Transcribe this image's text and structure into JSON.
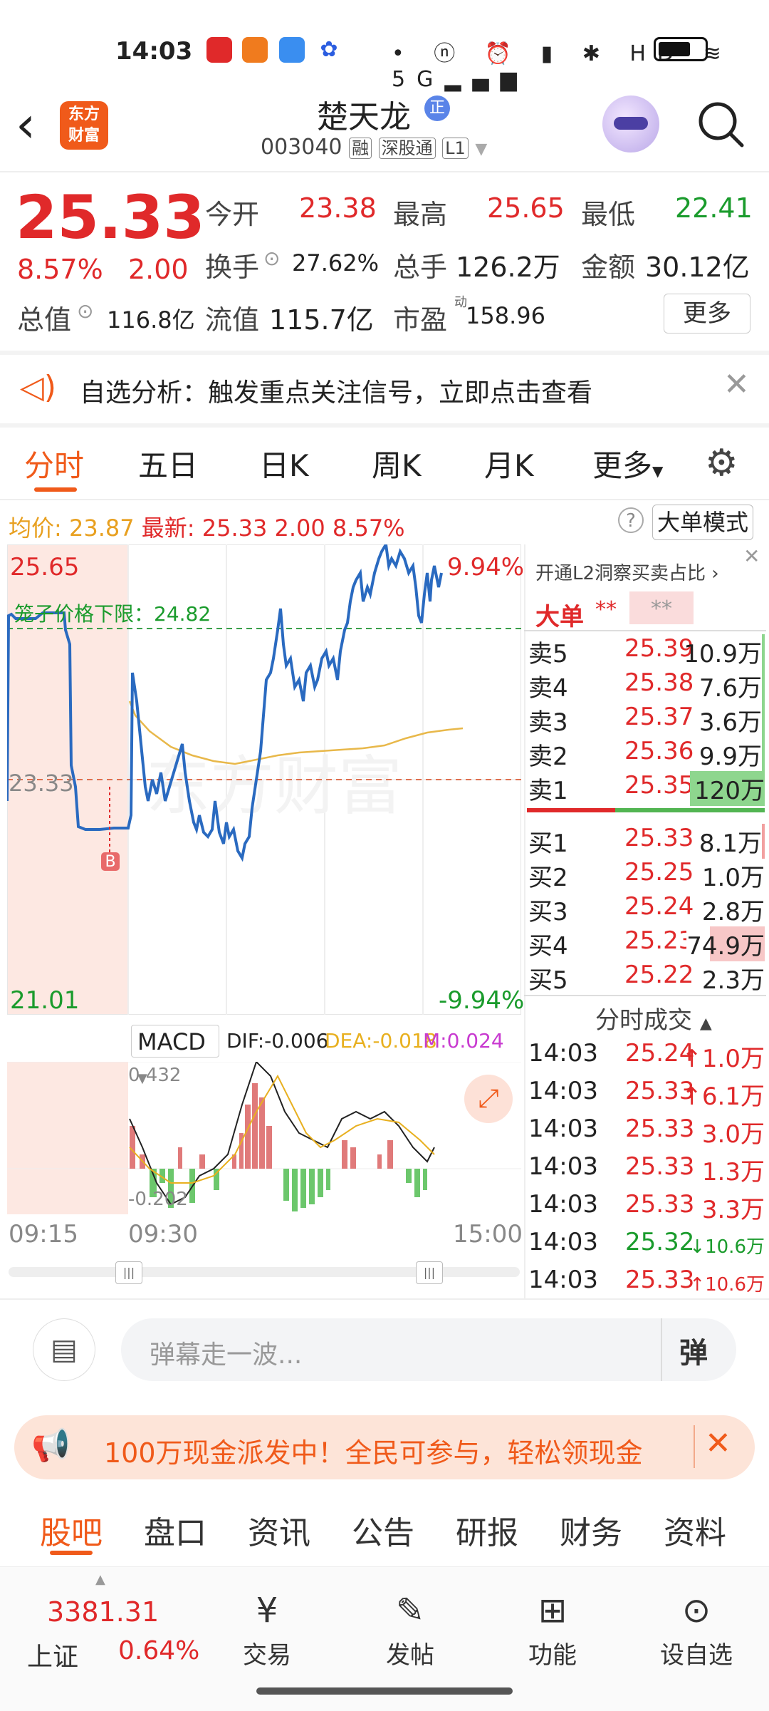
{
  "status": {
    "time": "14:03",
    "icons": "• ⓝ ⏰ ▮ ✱ HD ≋ 5G▂▄▆"
  },
  "header": {
    "logo_top": "东方",
    "logo_bottom": "财富",
    "stock_name": "楚天龙",
    "badge": "正",
    "code": "003040",
    "tag1": "融",
    "tag2": "深股通",
    "tag3": "L1"
  },
  "quote": {
    "price": "25.33",
    "change_pct": "8.57%",
    "change": "2.00",
    "open_label": "今开",
    "open": "23.38",
    "high_label": "最高",
    "high": "25.65",
    "low_label": "最低",
    "low": "22.41",
    "turnover_label": "换手",
    "turnover": "27.62%",
    "volume_label": "总手",
    "volume": "126.2万",
    "amount_label": "金额",
    "amount": "30.12亿",
    "mktcap_label": "总值",
    "mktcap": "116.8亿",
    "float_label": "流值",
    "float": "115.7亿",
    "pe_label": "市盈",
    "pe_sup": "动",
    "pe": "158.96",
    "more": "更多"
  },
  "notice": {
    "text": "自选分析：触发重点关注信号，立即点击查看"
  },
  "tabs": [
    "分时",
    "五日",
    "日K",
    "周K",
    "月K",
    "更多"
  ],
  "chart_info": {
    "avg_label": "均价:",
    "avg": "23.87",
    "last_label": "最新:",
    "last": "25.33",
    "chg": "2.00",
    "pct": "8.57%",
    "mode_button": "大单模式"
  },
  "chart": {
    "top_price": "25.65",
    "top_pct": "9.94%",
    "mid_price": "23.33",
    "bottom_price": "21.01",
    "bottom_pct": "-9.94%",
    "limit_label": "笼子价格下限：24.82",
    "marker": "B",
    "watermark": "东方财富"
  },
  "macd": {
    "selector": "MACD",
    "dif": "DIF:-0.006",
    "dea": "DEA:-0.018",
    "m": "M:0.024",
    "top": "0.432",
    "bottom": "-0.202",
    "t_start": "09:15",
    "t_open": "09:30",
    "t_end": "15:00"
  },
  "orderbook": {
    "promo": "开通L2洞察买卖占比",
    "bigorder_label": "大单",
    "bigorder_val1": "**",
    "bigorder_val2": "**",
    "asks": [
      {
        "label": "卖5",
        "price": "25.39",
        "vol": "10.9万"
      },
      {
        "label": "卖4",
        "price": "25.38",
        "vol": "7.6万"
      },
      {
        "label": "卖3",
        "price": "25.37",
        "vol": "3.6万"
      },
      {
        "label": "卖2",
        "price": "25.36",
        "vol": "9.9万"
      },
      {
        "label": "卖1",
        "price": "25.35",
        "vol": "120万"
      }
    ],
    "bids": [
      {
        "label": "买1",
        "price": "25.33",
        "vol": "8.1万"
      },
      {
        "label": "买2",
        "price": "25.25",
        "vol": "1.0万"
      },
      {
        "label": "买3",
        "price": "25.24",
        "vol": "2.8万"
      },
      {
        "label": "买4",
        "price": "25.23",
        "vol": "74.9万"
      },
      {
        "label": "买5",
        "price": "25.22",
        "vol": "2.3万"
      }
    ],
    "ticks_header": "分时成交",
    "ticks": [
      {
        "t": "14:03",
        "p": "25.24",
        "v": "↑1.0万"
      },
      {
        "t": "14:03",
        "p": "25.33",
        "v": "↑6.1万"
      },
      {
        "t": "14:03",
        "p": "25.33",
        "v": "3.0万"
      },
      {
        "t": "14:03",
        "p": "25.33",
        "v": "1.3万"
      },
      {
        "t": "14:03",
        "p": "25.33",
        "v": "3.3万"
      },
      {
        "t": "14:03",
        "p": "25.32",
        "v": "↓10.6万"
      },
      {
        "t": "14:03",
        "p": "25.33",
        "v": "↑10.6万"
      }
    ]
  },
  "danmu": {
    "placeholder": "弹幕走一波...",
    "button": "弹"
  },
  "banner": {
    "text": "100万现金派发中！全民可参与，轻松领现金"
  },
  "bottom_tabs": [
    "股吧",
    "盘口",
    "资讯",
    "公告",
    "研报",
    "财务",
    "资料"
  ],
  "index": {
    "value": "3381.31",
    "name": "上证",
    "pct": "0.64%"
  },
  "nav": [
    {
      "icon": "trade-icon",
      "label": "交易"
    },
    {
      "icon": "post-icon",
      "label": "发帖"
    },
    {
      "icon": "function-icon",
      "label": "功能"
    },
    {
      "icon": "watchlist-icon",
      "label": "设自选"
    }
  ],
  "colors": {
    "up": "#e0292a",
    "down": "#1a9b2c",
    "accent": "#f05a1a",
    "line": "#2a6ac0",
    "avg": "#e8b84a"
  }
}
